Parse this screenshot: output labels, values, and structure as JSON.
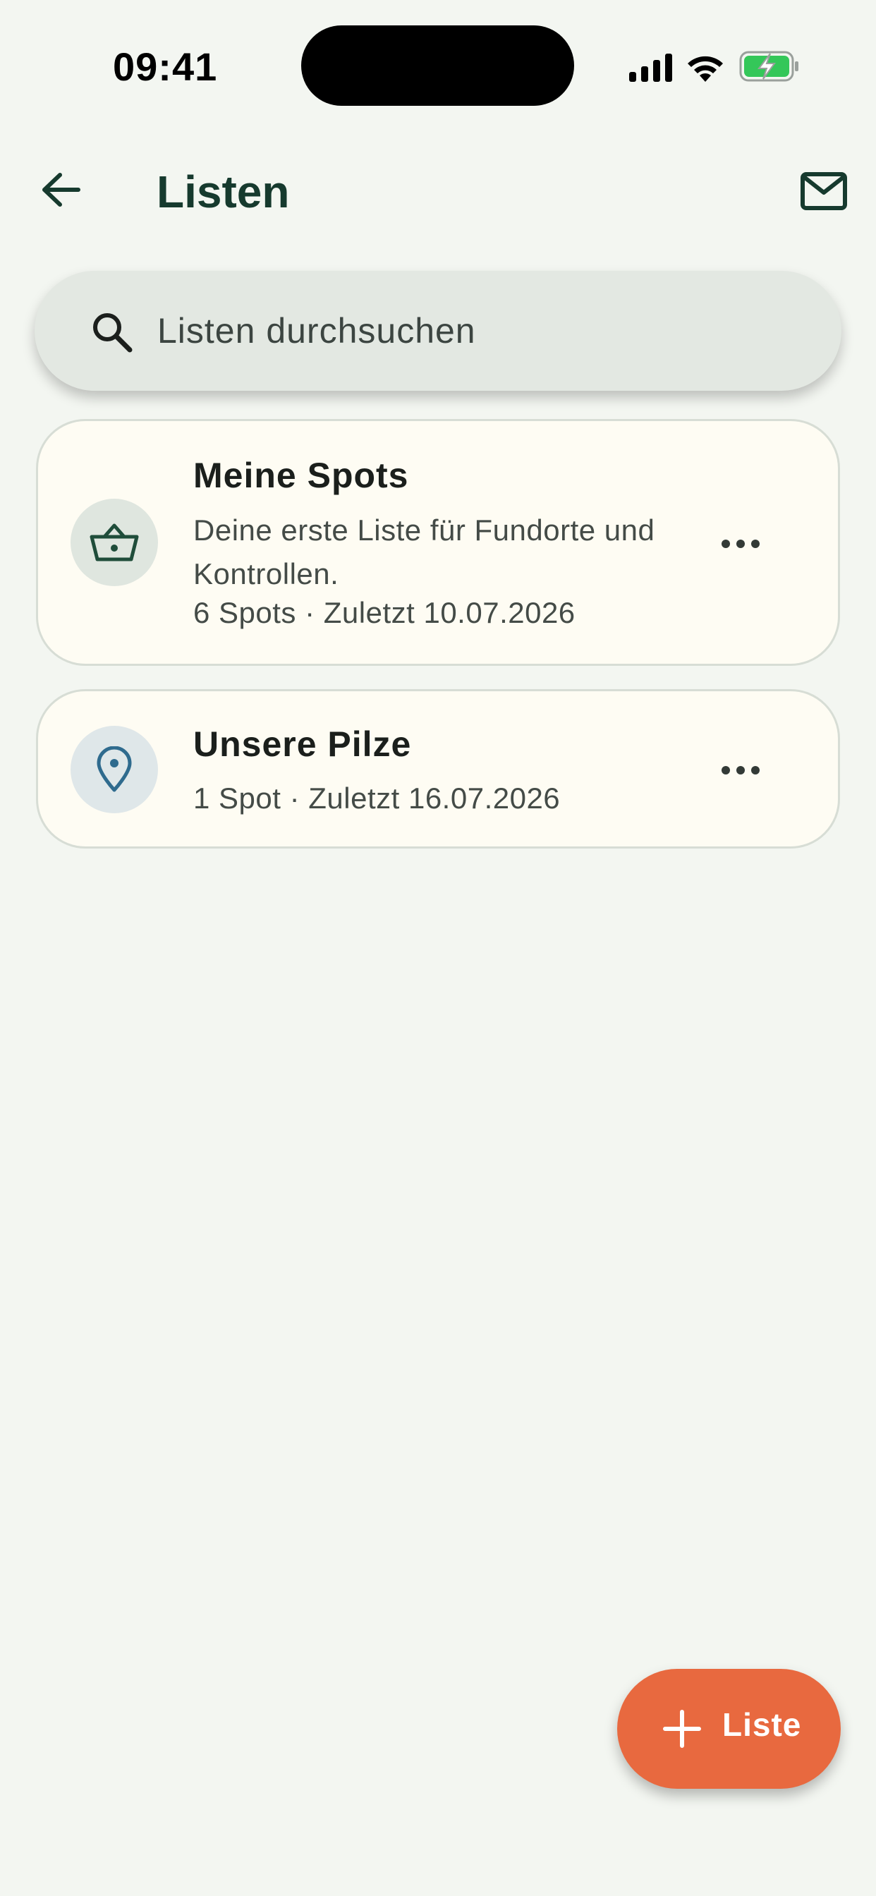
{
  "status_bar": {
    "time": "09:41",
    "icons": [
      "signal-icon",
      "wifi-icon",
      "battery-charging-icon"
    ],
    "battery_color": "#34c759"
  },
  "header": {
    "title": "Listen",
    "back_icon": "arrow-left-icon",
    "mail_icon": "mail-icon"
  },
  "search": {
    "placeholder": "Listen durchsuchen",
    "value": "",
    "icon": "search-icon"
  },
  "lists": [
    {
      "title": "Meine Spots",
      "description": "Deine erste Liste für Fundorte und Kontrollen.",
      "meta": "6 Spots · Zuletzt 10.07.2026",
      "icon": "basket-icon",
      "icon_color": "#1f4d3a"
    },
    {
      "title": "Unsere Pilze",
      "meta": "1 Spot · Zuletzt 16.07.2026",
      "icon": "location-pin-icon",
      "icon_color": "#2f6b8e"
    }
  ],
  "fab": {
    "label": "Liste",
    "icon": "plus-icon",
    "color": "#e8693f"
  },
  "colors": {
    "background": "#f3f6f1",
    "primary_dark": "#163a2e",
    "card": "#fefcf3",
    "accent": "#e8693f"
  }
}
